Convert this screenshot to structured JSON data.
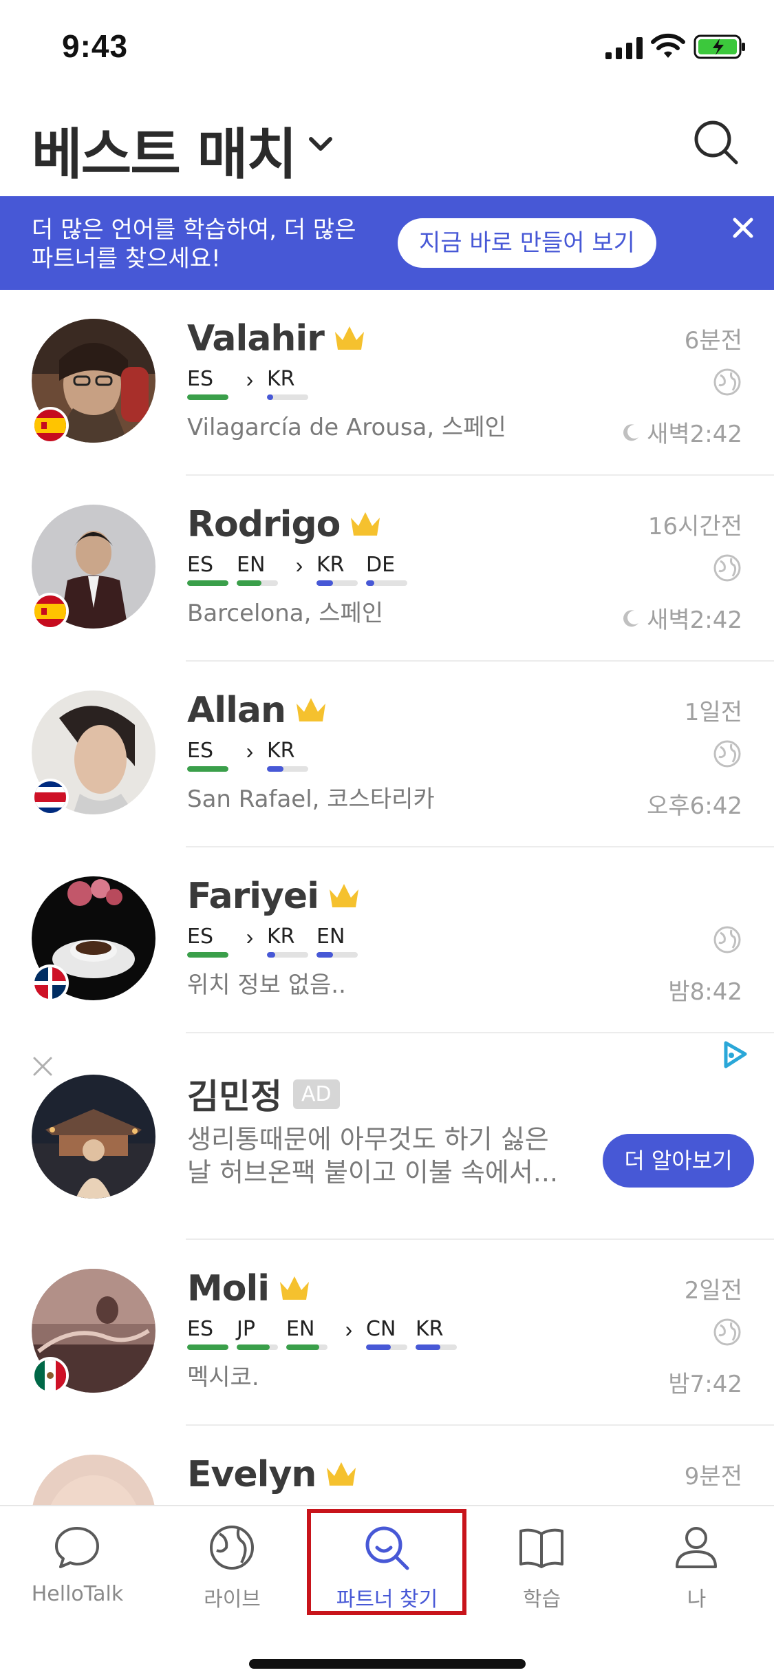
{
  "status_bar": {
    "time": "9:43"
  },
  "header": {
    "title": "베스트 매치"
  },
  "banner": {
    "text_line1": "더 많은 언어를 학습하여, 더 많은",
    "text_line2": "파트너를 찾으세요!",
    "button_label": "지금 바로 만들어 보기"
  },
  "partners": [
    {
      "name": "Valahir",
      "langs_native": [
        {
          "code": "ES",
          "level": 1.0
        }
      ],
      "langs_learning": [
        {
          "code": "KR",
          "level": 0.15
        }
      ],
      "location": "Vilagarcía de Arousa, 스페인",
      "time_ago": "6분전",
      "local_time": "새벽2:42",
      "local_time_icon": "moon-icon",
      "flag": "spain"
    },
    {
      "name": "Rodrigo",
      "langs_native": [
        {
          "code": "ES",
          "level": 1.0
        },
        {
          "code": "EN",
          "level": 0.6
        }
      ],
      "langs_learning": [
        {
          "code": "KR",
          "level": 0.4
        },
        {
          "code": "DE",
          "level": 0.2
        }
      ],
      "location": "Barcelona, 스페인",
      "time_ago": "16시간전",
      "local_time": "새벽2:42",
      "local_time_icon": "moon-icon",
      "flag": "spain"
    },
    {
      "name": "Allan",
      "langs_native": [
        {
          "code": "ES",
          "level": 1.0
        }
      ],
      "langs_learning": [
        {
          "code": "KR",
          "level": 0.4
        }
      ],
      "location": "San Rafael, 코스타리카",
      "time_ago": "1일전",
      "local_time": "오후6:42",
      "local_time_icon": "",
      "flag": "costa-rica"
    },
    {
      "name": "Fariyei",
      "langs_native": [
        {
          "code": "ES",
          "level": 1.0
        }
      ],
      "langs_learning": [
        {
          "code": "KR",
          "level": 0.2
        },
        {
          "code": "EN",
          "level": 0.4
        }
      ],
      "location": "위치 정보 없음..",
      "time_ago": "",
      "local_time": "밤8:42",
      "local_time_icon": "",
      "flag": "dominican-republic"
    }
  ],
  "ad": {
    "name": "김민정",
    "badge": "AD",
    "text_line1": "생리통때문에 아무것도 하기 싫은",
    "text_line2": "날 허브온팩 붙이고 이불 속에서...",
    "button_label": "더 알아보기"
  },
  "partners_after_ad": [
    {
      "name": "Moli",
      "langs_native": [
        {
          "code": "ES",
          "level": 1.0
        },
        {
          "code": "JP",
          "level": 0.8
        },
        {
          "code": "EN",
          "level": 0.8
        }
      ],
      "langs_learning": [
        {
          "code": "CN",
          "level": 0.6
        },
        {
          "code": "KR",
          "level": 0.6
        }
      ],
      "location": "멕시코.",
      "time_ago": "2일전",
      "local_time": "밤7:42",
      "local_time_icon": "",
      "flag": "mexico"
    },
    {
      "name": "Evelyn",
      "time_ago": "9분전"
    }
  ],
  "tabs": [
    {
      "label": "HelloTalk",
      "icon": "chat-bubble-icon"
    },
    {
      "label": "라이브",
      "icon": "globe-icon"
    },
    {
      "label": "파트너 찾기",
      "icon": "search-partner-icon",
      "active": true
    },
    {
      "label": "학습",
      "icon": "book-icon"
    },
    {
      "label": "나",
      "icon": "person-icon"
    }
  ],
  "colors": {
    "accent": "#4758d6",
    "native_bar": "#3a9f4a",
    "learning_bar": "#4758d6",
    "crown": "#f5c12e",
    "highlight": "#c8141b"
  }
}
